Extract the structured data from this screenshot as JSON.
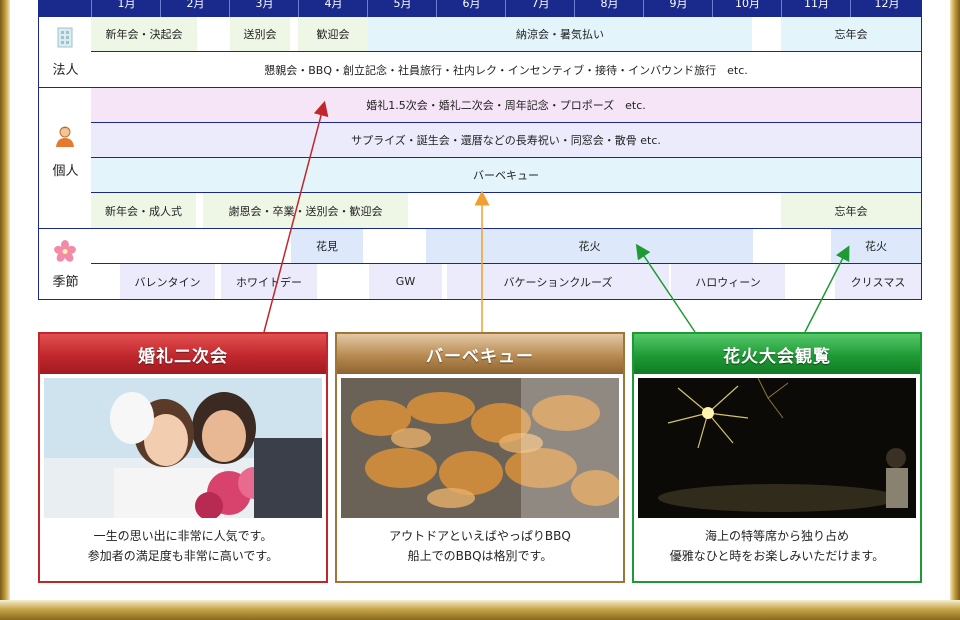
{
  "months": [
    "1月",
    "2月",
    "3月",
    "4月",
    "5月",
    "6月",
    "7月",
    "8月",
    "9月",
    "10月",
    "11月",
    "12月"
  ],
  "categories": {
    "corporate": "法人",
    "individual": "個人",
    "season": "季節"
  },
  "corporate_rows": [
    [
      "新年会・決起会",
      "送別会",
      "歓迎会",
      "納涼会・暑気払い",
      "忘年会"
    ],
    [
      "懇親会・BBQ・創立記念・社員旅行・社内レク・インセンティブ・接待・インバウンド旅行　etc."
    ]
  ],
  "individual_rows": [
    [
      "婚礼1.5次会・婚礼二次会・周年記念・プロポーズ　etc."
    ],
    [
      "サプライズ・誕生会・還暦などの長寿祝い・同窓会・散骨 etc."
    ],
    [
      "バーベキュー"
    ],
    [
      "新年会・成人式",
      "謝恩会・卒業・送別会・歓迎会",
      "忘年会"
    ]
  ],
  "season_rows": [
    [
      "花見",
      "花火",
      "花火"
    ],
    [
      "バレンタイン",
      "ホワイトデー",
      "GW",
      "バケーションクルーズ",
      "ハロウィーン",
      "クリスマス"
    ]
  ],
  "cards": [
    {
      "title": "婚礼二次会",
      "line1": "一生の思い出に非常に人気です。",
      "line2": "参加者の満足度も非常に高いです。"
    },
    {
      "title": "バーベキュー",
      "line1": "アウトドアといえばやっぱりBBQ",
      "line2": "船上でのBBQは格別です。"
    },
    {
      "title": "花火大会観覧",
      "line1": "海上の特等席から独り占め",
      "line2": "優雅なひと時をお楽しみいただけます。"
    }
  ],
  "colors": {
    "navy": "#1a2a8c",
    "red": "#c0272d",
    "brown": "#a07636",
    "green": "#1e9a35"
  },
  "icons": [
    "building-icon",
    "person-icon",
    "sakura-icon"
  ]
}
